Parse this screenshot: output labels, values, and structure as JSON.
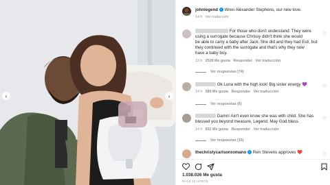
{
  "post": {
    "username": "johnlegend",
    "caption": "Wren Alexander Stephens, our new love.",
    "time": "14 h",
    "see_translation": "Ver traducción",
    "likes": "1.038.026 Me gusta",
    "posted_ago": "HACE 14 HORAS",
    "verified_color": "#0095f6"
  },
  "comments": [
    {
      "username_hidden": true,
      "lines": [
        "For those who don't understand: They were",
        "using a surrogate because Chrissy didn't think she would",
        "be able to carry a baby after Jack. She did and they had Esti, but",
        "they continued with the surrogate and that's why they now",
        "have a baby boy."
      ],
      "time": "13 h",
      "likes": "2528 Me gusta",
      "reply": "Responder",
      "translate": "Ver traducción",
      "replies": "Ver respuestas (74)"
    },
    {
      "username_hidden": true,
      "lines": [
        "Ok Luna with the high kick! Big sister energy"
      ],
      "emoji": "💜",
      "time": "14 h",
      "likes": "589 Me gusta",
      "reply": "Responder",
      "translate": "Ver traducción",
      "replies": "Ver respuestas (6)"
    },
    {
      "username_hidden": true,
      "lines": [
        "Damn! Ain't even know she was with child. She has",
        "blessed you beyond measure, Legend. May God bless."
      ],
      "time": "14 h",
      "likes": "832 Me gusta",
      "reply": "Responder",
      "translate": "Ver traducción",
      "replies": "Ver respuestas (15)"
    },
    {
      "username": "thechristycarlsonromano",
      "text": "Ren Stevens approves",
      "emoji": "❤️"
    }
  ],
  "icons": [
    "heart-icon",
    "comment-icon",
    "share-icon",
    "bookmark-icon",
    "verified-icon",
    "chevron-left-icon",
    "chevron-right-icon"
  ]
}
